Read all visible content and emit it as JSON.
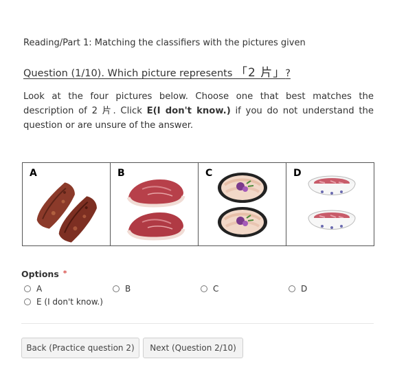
{
  "section_title": "Reading/Part 1: Matching the classifiers with the pictures given",
  "question": {
    "prefix": "Question (1/10). Which picture represents ",
    "classifier": "「2 片」",
    "suffix": "?"
  },
  "instructions": {
    "part1": "Look at the four pictures below. Choose one that best matches the description of 2 片. Click ",
    "bold": "E(I don't know.)",
    "part2": " if you do not understand the question or are unsure of the answer."
  },
  "pictures": [
    {
      "letter": "A",
      "icon": "dried-meat-strips-icon"
    },
    {
      "letter": "B",
      "icon": "raw-steak-icon"
    },
    {
      "letter": "C",
      "icon": "sliced-meat-plate-icon"
    },
    {
      "letter": "D",
      "icon": "meat-bowl-icon"
    }
  ],
  "options": {
    "label": "Options",
    "required_marker": "*",
    "items": [
      "A",
      "B",
      "C",
      "D",
      "E (I don't know.)"
    ]
  },
  "buttons": {
    "back": "Back (Practice question 2)",
    "next": "Next (Question 2/10)"
  },
  "colors": {
    "required": "#d9534f",
    "border": "#555555"
  }
}
